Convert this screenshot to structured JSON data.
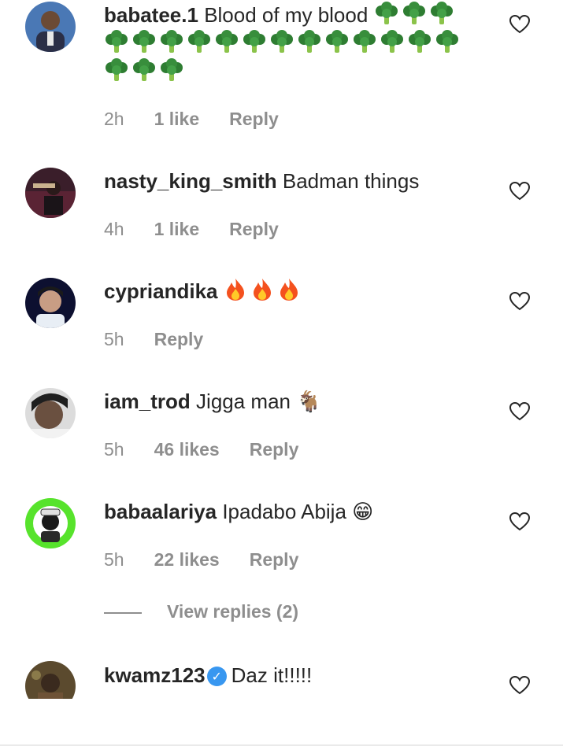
{
  "comments": [
    {
      "username": "babatee.1",
      "text": "Blood of my blood",
      "emoji": "broccoli",
      "emoji_count": 19,
      "time": "2h",
      "likes": "1 like",
      "reply": "Reply"
    },
    {
      "username": "nasty_king_smith",
      "text": "Badman things",
      "time": "4h",
      "likes": "1 like",
      "reply": "Reply"
    },
    {
      "username": "cypriandika",
      "text": "",
      "emoji": "fire",
      "emoji_count": 3,
      "time": "5h",
      "reply": "Reply"
    },
    {
      "username": "iam_trod",
      "text": "Jigga man",
      "emoji_char": "🐐",
      "time": "5h",
      "likes": "46 likes",
      "reply": "Reply"
    },
    {
      "username": "babaalariya",
      "text": "Ipadabo Abija",
      "emoji_char": "😁",
      "time": "5h",
      "likes": "22 likes",
      "reply": "Reply",
      "view_replies": "View replies (2)"
    },
    {
      "username": "kwamz123",
      "verified": true,
      "text": "Daz it!!!!!"
    }
  ],
  "icons": {
    "like": "heart-outline-icon",
    "verified": "verified-badge-icon"
  },
  "colors": {
    "text": "#262626",
    "meta": "#8e8e8e",
    "verified": "#3897f0"
  }
}
